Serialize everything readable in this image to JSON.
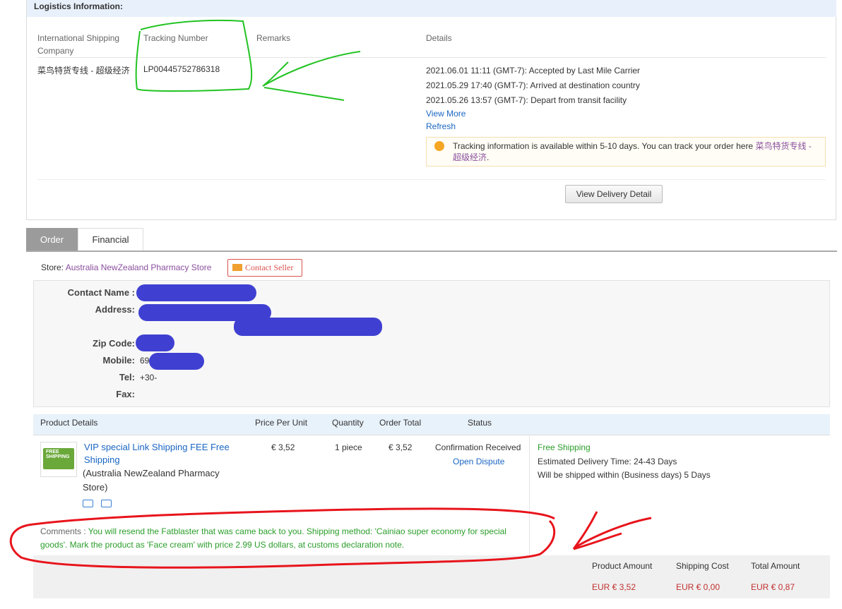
{
  "logistics": {
    "title": "Logistics Information:",
    "columns": {
      "company": "International Shipping Company",
      "tracking": "Tracking Number",
      "remarks": "Remarks",
      "details": "Details"
    },
    "company": "菜鸟特货专线 - 超级经济",
    "tracking_number": "LP00445752786318",
    "events": [
      "2021.06.01 11:11 (GMT-7): Accepted by Last Mile Carrier",
      "2021.05.29 17:40 (GMT-7): Arrived at destination country",
      "2021.05.26 13:57 (GMT-7): Depart from transit facility"
    ],
    "view_more": "View More",
    "refresh": "Refresh",
    "tip_text": "Tracking information is available within 5-10 days. You can track your order here ",
    "tip_link": "菜鸟特货专线 - 超级经济",
    "tip_end": ".",
    "view_delivery_button": "View Delivery Detail"
  },
  "tabs": [
    "Order",
    "Financial"
  ],
  "store": {
    "label": "Store:",
    "name": "Australia NewZealand Pharmacy Store",
    "contact_button": "Contact Seller"
  },
  "address": {
    "contact_name_label": "Contact Name :",
    "address_label": "Address:",
    "zip_label": "Zip Code:",
    "mobile_label": "Mobile:",
    "mobile_value": "69",
    "tel_label": "Tel:",
    "tel_value": "+30-",
    "fax_label": "Fax:"
  },
  "product_table": {
    "headers": [
      "Product Details",
      "Price Per Unit",
      "Quantity",
      "Order Total",
      "Status"
    ],
    "product_name": "VIP special Link Shipping FEE Free Shipping",
    "product_store": "(Australia NewZealand Pharmacy Store)",
    "thumb_label": "FREE SHIPPING",
    "price": "€ 3,52",
    "quantity": "1 piece",
    "order_total": "€ 3,52",
    "status": "Confirmation Received",
    "open_dispute": "Open Dispute",
    "shipping_free": "Free Shipping",
    "estimated_delivery": "Estimated Delivery Time: 24-43 Days",
    "shipped_within": "Will be shipped within (Business days) 5 Days"
  },
  "comments": {
    "label": "Comments :",
    "text": " You will resend the Fatblaster that was came back to you. Shipping method: 'Cainiao super economy for special goods'. Mark the product as 'Face cream' with price 2.99 US dollars, at customs declaration note."
  },
  "totals": {
    "headers": [
      "Product Amount",
      "Shipping Cost",
      "Total Amount"
    ],
    "values": [
      "EUR € 3,52",
      "EUR € 0,00",
      "EUR € 0,87"
    ]
  },
  "colors": {
    "annotation_green": "#22c322",
    "annotation_red": "#e8141c",
    "redaction_blue": "#3f40d1",
    "link_blue": "#1a66c2",
    "price_red": "#c0302f"
  }
}
